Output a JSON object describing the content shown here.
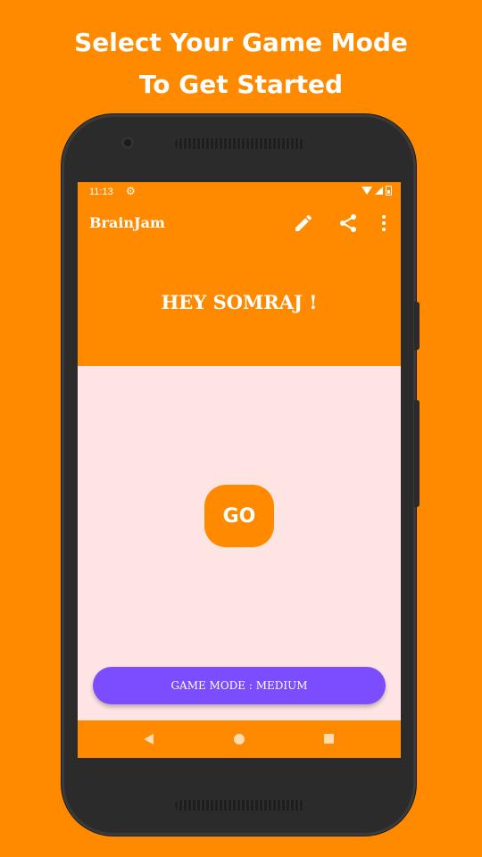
{
  "promo": {
    "line1": "Select Your Game Mode",
    "line2": "To Get Started"
  },
  "status_bar": {
    "time": "11:13",
    "icons": [
      "settings-icon",
      "wifi-icon",
      "signal-icon",
      "battery-icon"
    ]
  },
  "app_bar": {
    "title": "BrainJam",
    "actions": [
      "edit-icon",
      "share-icon",
      "more-vert-icon"
    ]
  },
  "greeting": "HEY SOMRAJ !",
  "go_button": "GO",
  "game_mode_button": "GAME MODE : MEDIUM",
  "nav_bar": [
    "back-icon",
    "home-icon",
    "recents-icon"
  ],
  "colors": {
    "background": "#FF8A00",
    "primary": "#FF8A00",
    "accent": "#7B4DFF",
    "content_bg": "#FFE4E4"
  }
}
